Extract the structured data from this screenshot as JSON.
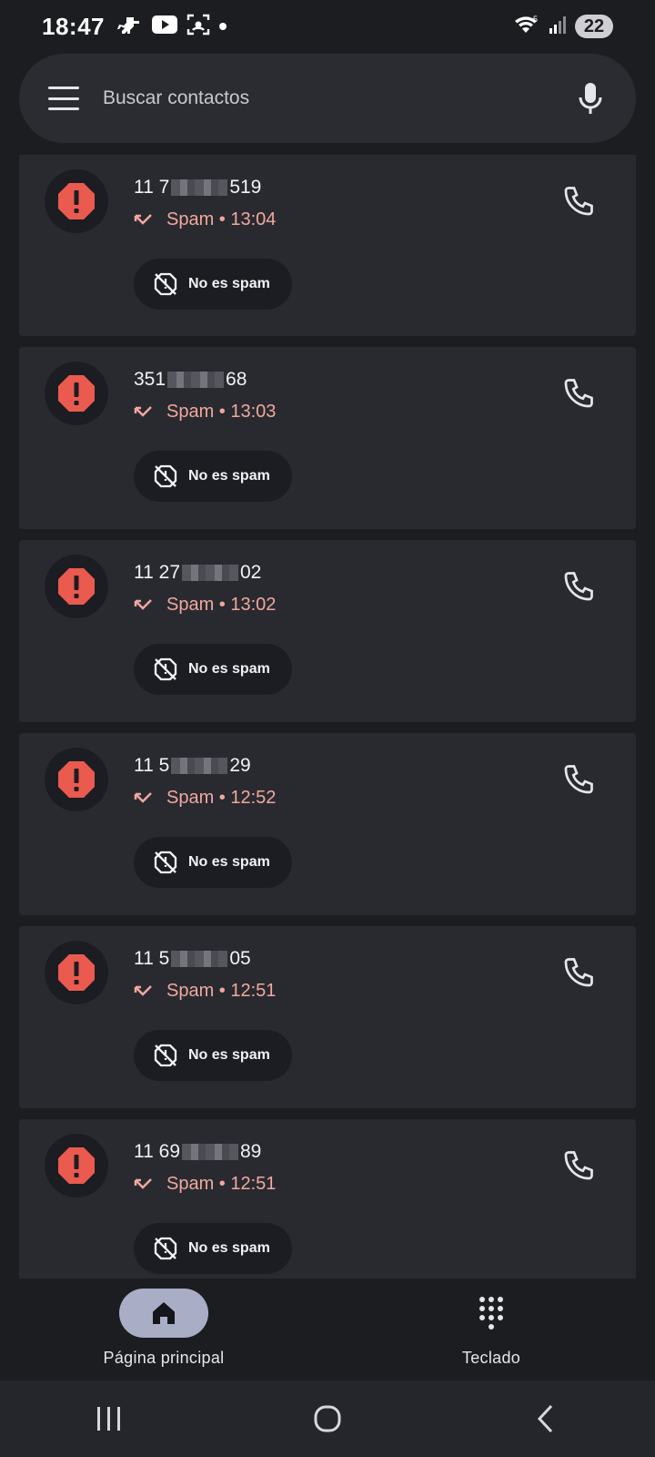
{
  "status_bar": {
    "time": "18:47",
    "left_icons": [
      "dino-icon",
      "youtube-icon",
      "screenshot-icon",
      "dot-icon"
    ],
    "right_icons": [
      "wifi-icon",
      "signal-icon"
    ],
    "battery": "22"
  },
  "search": {
    "placeholder": "Buscar contactos",
    "menu_icon": "menu-icon",
    "mic_icon": "mic-icon"
  },
  "calls": [
    {
      "prefix": "11 7",
      "suffix": "519",
      "status": "Spam • 13:04",
      "action": "No es spam"
    },
    {
      "prefix": "351 ",
      "suffix": "68",
      "status": "Spam • 13:03",
      "action": "No es spam"
    },
    {
      "prefix": "11 27",
      "suffix": "02",
      "status": "Spam • 13:02",
      "action": "No es spam"
    },
    {
      "prefix": "11 5",
      "suffix": "29",
      "status": "Spam • 12:52",
      "action": "No es spam"
    },
    {
      "prefix": "11 5",
      "suffix": "05",
      "status": "Spam • 12:51",
      "action": "No es spam"
    },
    {
      "prefix": "11 69",
      "suffix": "89",
      "status": "Spam • 12:51",
      "action": "No es spam"
    }
  ],
  "bottom_nav": {
    "home_label": "Página principal",
    "keypad_label": "Teclado"
  },
  "colors": {
    "background": "#1c1d21",
    "card": "#292a30",
    "spam_red": "#ea5a4f",
    "spam_text": "#f0a89e",
    "active_pill": "#a9aec6"
  }
}
